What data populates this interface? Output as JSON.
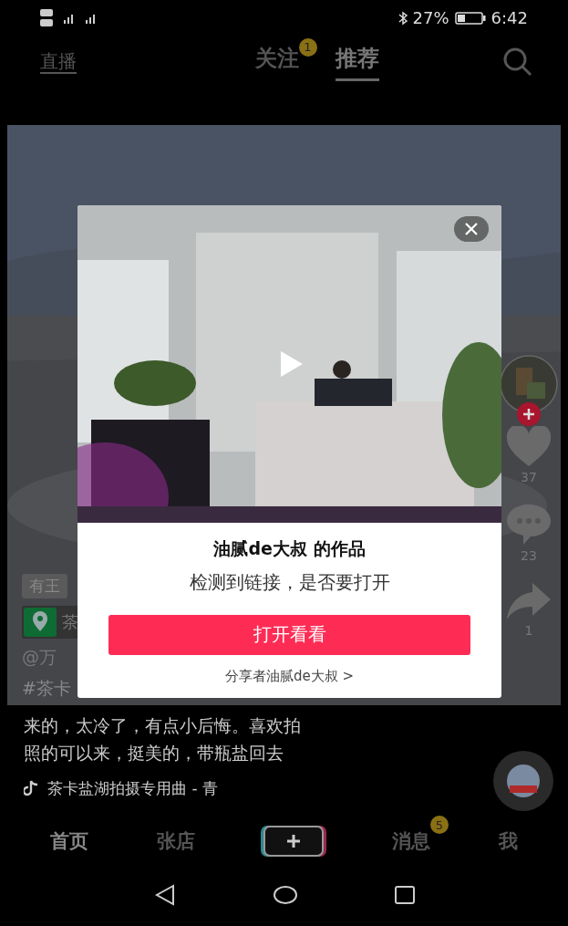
{
  "status_bar": {
    "battery": "27%",
    "time": "6:42"
  },
  "top_nav": {
    "live_label": "直播",
    "tabs": [
      {
        "label": "关注",
        "selected": false,
        "badge": "1"
      },
      {
        "label": "推荐",
        "selected": true
      }
    ]
  },
  "video": {
    "tag": "有王",
    "location": "茶",
    "author": "@万",
    "hashtag": "#茶卡",
    "likes": "37",
    "comments": "23",
    "shares": "1",
    "caption": [
      "来的，太冷了，有点小后悔。喜欢拍",
      "照的可以来，挺美的，带瓶盐回去"
    ],
    "music": "茶卡盐湖拍摄专用曲 - 青"
  },
  "dialog": {
    "title": "油腻de大叔 的作品",
    "message": "检测到链接，是否要打开",
    "button": "打开看看",
    "sharer_link": "分享者油腻de大叔 >"
  },
  "bottom_nav": [
    {
      "kind": "tab",
      "label": "首页",
      "selected": true
    },
    {
      "kind": "tab",
      "label": "张店",
      "selected": false
    },
    {
      "kind": "add"
    },
    {
      "kind": "tab",
      "label": "消息",
      "selected": false,
      "badge": "5"
    },
    {
      "kind": "tab",
      "label": "我",
      "selected": false
    }
  ]
}
